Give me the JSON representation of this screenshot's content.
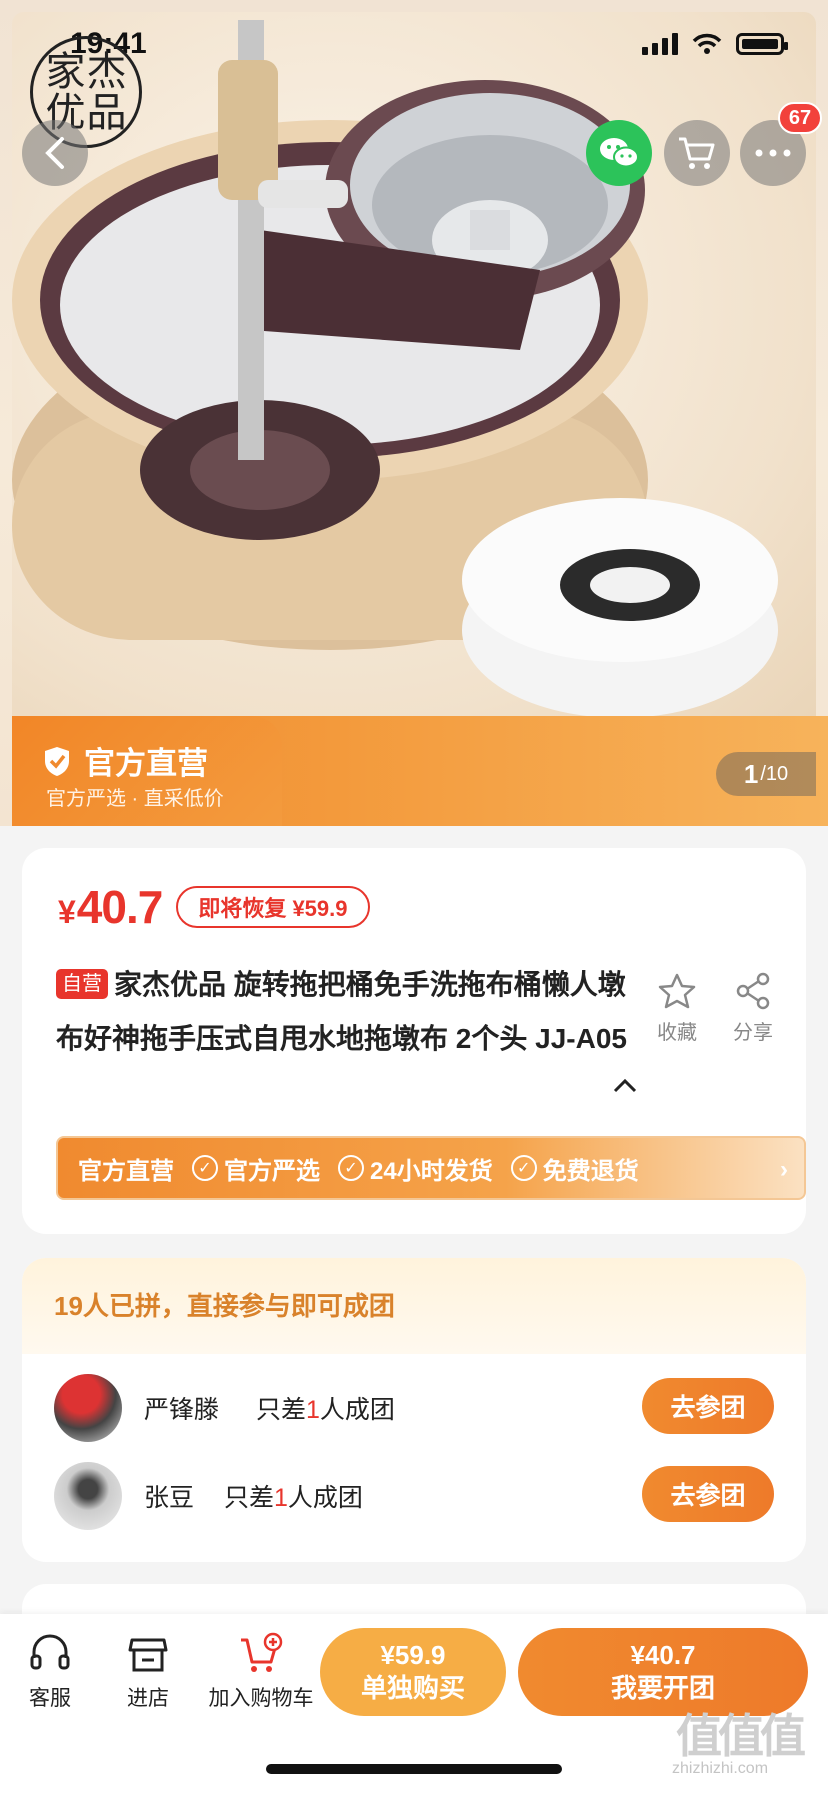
{
  "status_bar": {
    "time": "19:41"
  },
  "hero": {
    "logo_chars": [
      "家",
      "杰",
      "优",
      "品"
    ],
    "cart_badge": "67",
    "official_title": "官方直营",
    "official_sub": "官方严选 · 直采低价",
    "pager_current": "1",
    "pager_total": "/10"
  },
  "product": {
    "currency": "¥",
    "price": "40.7",
    "restore_tag": "即将恢复 ¥59.9",
    "self_tag": "自营",
    "title": "家杰优品 旋转拖把桶免手洗拖布桶懒人墩布好神拖手压式自甩水地拖墩布 2个头 JJ-A05",
    "fav_label": "收藏",
    "share_label": "分享",
    "services": [
      "官方直营",
      "官方严选",
      "24小时发货",
      "免费退货"
    ]
  },
  "group": {
    "header": "19人已拼，直接参与即可成团",
    "rows": [
      {
        "name": "严锋滕",
        "need_prefix": "只差",
        "need_num": "1",
        "need_suffix": "人成团",
        "button": "去参团"
      },
      {
        "name": "张豆",
        "need_prefix": "只差",
        "need_num": "1",
        "need_suffix": "人成团",
        "button": "去参团"
      }
    ]
  },
  "bottom_bar": {
    "service_label": "客服",
    "shop_label": "进店",
    "cart_label": "加入购物车",
    "solo_price": "¥59.9",
    "solo_label": "单独购买",
    "group_price": "¥40.7",
    "group_label": "我要开团"
  },
  "watermark": {
    "main": "值值值",
    "sub": "zhizhizhi.com"
  },
  "colors": {
    "accent": "#f08a2f",
    "price_red": "#e8352c",
    "wechat": "#2cc35a"
  }
}
